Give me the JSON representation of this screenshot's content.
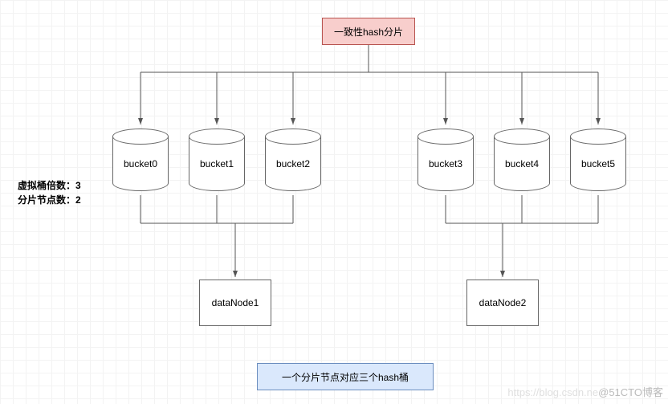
{
  "title": "一致性hash分片",
  "buckets": [
    "bucket0",
    "bucket1",
    "bucket2",
    "bucket3",
    "bucket4",
    "bucket5"
  ],
  "dataNodes": [
    "dataNode1",
    "dataNode2"
  ],
  "sideLabels": {
    "virtualBucketFactor": "虚拟桶倍数：3",
    "shardNodeCount": "分片节点数：2"
  },
  "caption": "一个分片节点对应三个hash桶",
  "watermark": {
    "faint": "https://blog.csdn.ne",
    "strong": "@51CTO博客"
  },
  "chart_data": {
    "type": "diagram",
    "root": "一致性hash分片",
    "virtual_bucket_factor": 3,
    "shard_node_count": 2,
    "buckets": [
      "bucket0",
      "bucket1",
      "bucket2",
      "bucket3",
      "bucket4",
      "bucket5"
    ],
    "data_nodes": [
      "dataNode1",
      "dataNode2"
    ],
    "bucket_to_node": {
      "bucket0": "dataNode1",
      "bucket1": "dataNode1",
      "bucket2": "dataNode1",
      "bucket3": "dataNode2",
      "bucket4": "dataNode2",
      "bucket5": "dataNode2"
    },
    "note": "一个分片节点对应三个hash桶"
  }
}
